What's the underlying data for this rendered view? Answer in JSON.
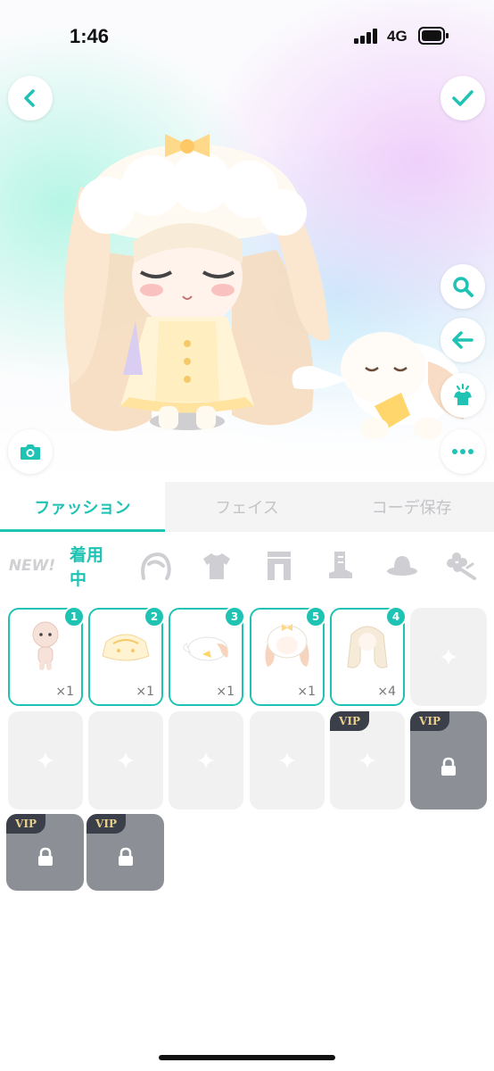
{
  "status_bar": {
    "time": "1:46",
    "network": "4G"
  },
  "colors": {
    "accent": "#1ec3b4",
    "tab_inactive": "#c4c4c8",
    "slot_empty": "#f1f1f2",
    "slot_locked": "#8c9096"
  },
  "toolbar": {
    "back_icon": "chevron-left-icon",
    "confirm_icon": "checkmark-icon",
    "camera_icon": "camera-icon",
    "side_buttons": [
      "search-icon",
      "undo-arrow-icon",
      "shirt-sparkle-icon",
      "more-icon"
    ]
  },
  "tabs": [
    {
      "label": "ファッション",
      "active": true
    },
    {
      "label": "フェイス",
      "active": false
    },
    {
      "label": "コーデ保存",
      "active": false
    }
  ],
  "categories": {
    "new_label": "NEW!",
    "wearing_label": "着用中",
    "icons": [
      "hair-icon",
      "shirt-icon",
      "pants-icon",
      "boots-icon",
      "hat-icon",
      "accessory-icon"
    ]
  },
  "items": [
    {
      "badge": "1",
      "count": "×1",
      "thumb": "body-thumb"
    },
    {
      "badge": "2",
      "count": "×1",
      "thumb": "dress-thumb"
    },
    {
      "badge": "3",
      "count": "×1",
      "thumb": "plush-thumb"
    },
    {
      "badge": "5",
      "count": "×1",
      "thumb": "bunny-hood-thumb"
    },
    {
      "badge": "4",
      "count": "×4",
      "thumb": "hair-thumb"
    }
  ],
  "vip_label": "VIP"
}
